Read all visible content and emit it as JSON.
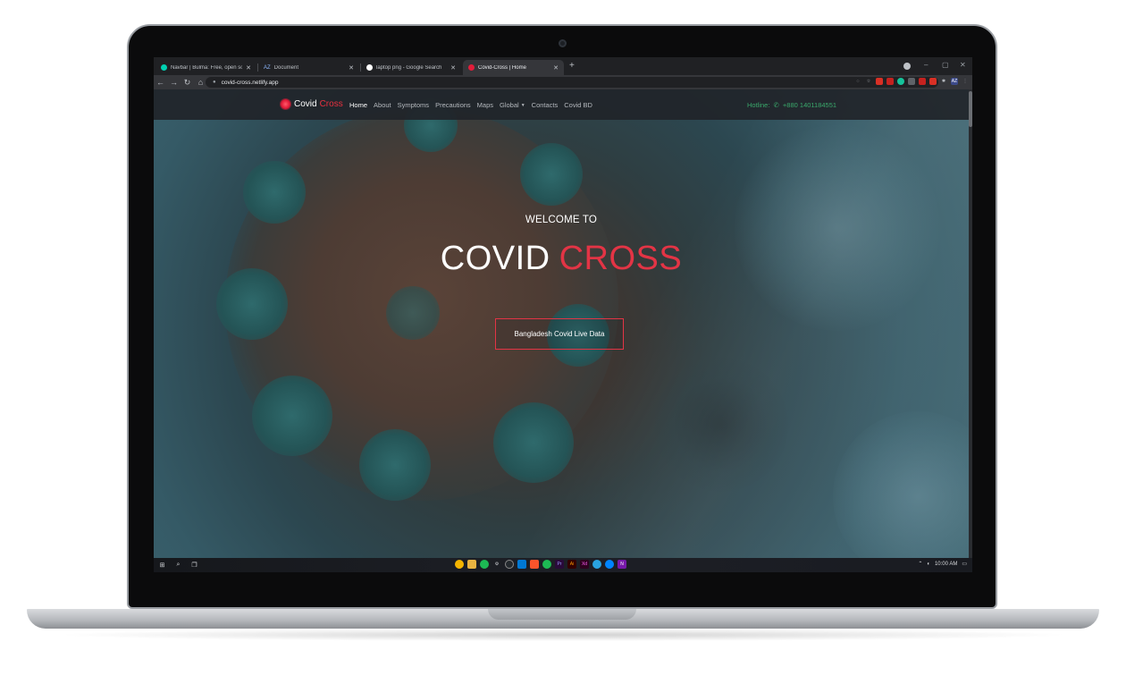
{
  "browser": {
    "tabs": [
      {
        "title": "Navbar | Bulma: Free, open sou",
        "favicon_color": "#00d1b2",
        "active": false
      },
      {
        "title": "Document",
        "favicon_color": "#8ab4f8",
        "active": false
      },
      {
        "title": "laptop png - Google Search",
        "favicon_color": "#ffffff",
        "active": false
      },
      {
        "title": "Covid-Cross | Home",
        "favicon_color": "#e31d3a",
        "active": true
      }
    ],
    "new_tab_symbol": "+",
    "close_symbol": "✕",
    "az_label": "AZ",
    "address": "covid-cross.netlify.app",
    "nav_icons": {
      "back": "←",
      "forward": "→",
      "reload": "↻",
      "home": "⌂"
    },
    "window_controls": {
      "minimize": "–",
      "maximize": "▢",
      "close": "✕"
    },
    "extension_icons": [
      "eye-off-icon",
      "star-icon",
      "red-extension-icon",
      "grammarly-icon",
      "puzzle-icon",
      "profile-icon",
      "menu-dots-icon"
    ]
  },
  "site": {
    "brand_primary": "Covid",
    "brand_accent": "Cross",
    "nav": [
      {
        "label": "Home",
        "active": true
      },
      {
        "label": "About"
      },
      {
        "label": "Symptoms"
      },
      {
        "label": "Precautions"
      },
      {
        "label": "Maps"
      },
      {
        "label": "Global",
        "dropdown": true
      },
      {
        "label": "Contacts"
      },
      {
        "label": "Covid BD"
      }
    ],
    "hotline_label": "Hotline:",
    "hotline_number": "+880 1401184551",
    "hero": {
      "welcome": "WELCOME TO",
      "title_primary": "COVID",
      "title_accent": "CROSS",
      "button_label": "Bangladesh Covid Live Data"
    },
    "colors": {
      "accent": "#e33445",
      "hotline": "#3aa86b",
      "navbar": "#212429"
    }
  },
  "taskbar": {
    "clock": "10:00 AM",
    "apps": [
      "chrome",
      "file-explorer",
      "spotify",
      "settings",
      "github",
      "vscode",
      "brave",
      "spotify-alt",
      "premiere",
      "illustrator",
      "xd",
      "telegram",
      "messenger",
      "onenote"
    ]
  }
}
